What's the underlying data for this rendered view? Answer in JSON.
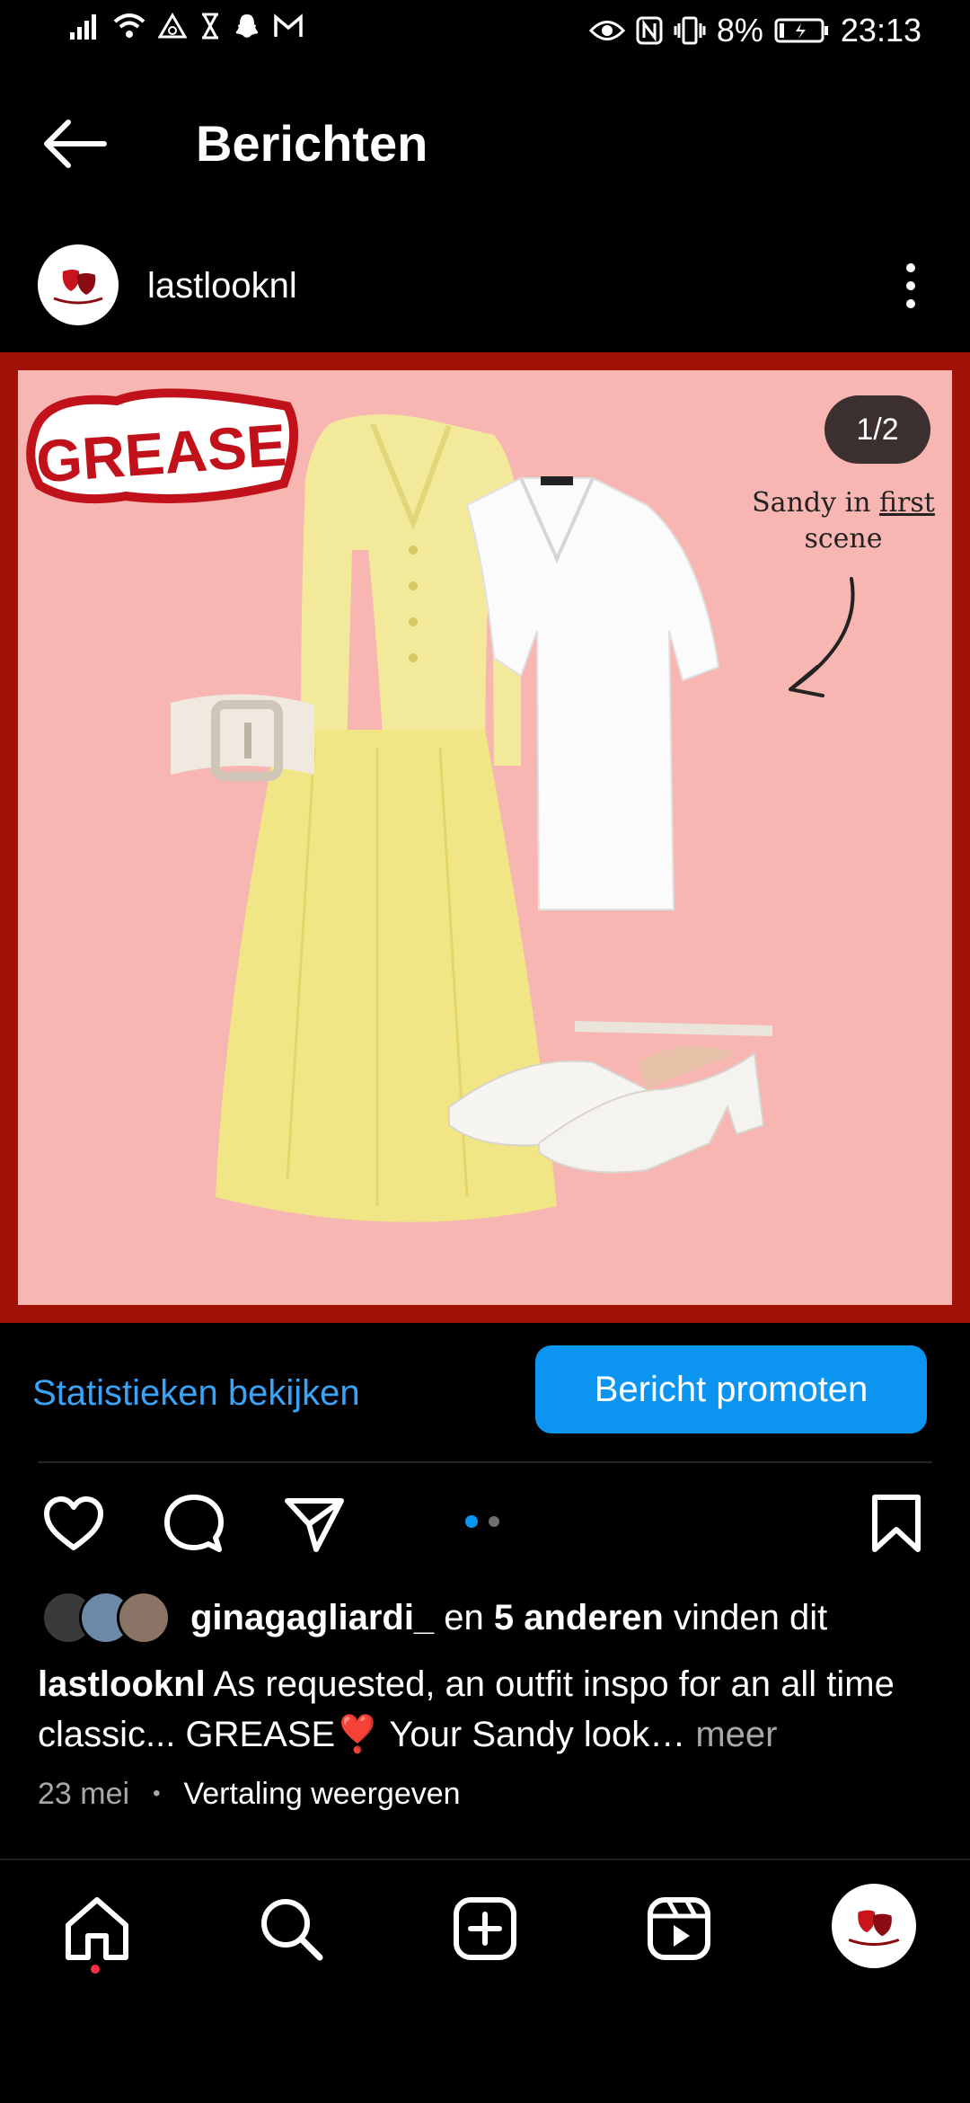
{
  "status_bar": {
    "left_icons": [
      "signal-icon",
      "wifi-icon",
      "alert-icon",
      "hourglass-icon",
      "snapchat-icon",
      "gmail-icon"
    ],
    "right_icons": [
      "eye-icon",
      "nfc-icon",
      "vibrate-icon"
    ],
    "battery": "8%",
    "time": "23:13"
  },
  "header": {
    "title": "Berichten"
  },
  "post": {
    "username": "lastlooknl",
    "image": {
      "counter": "1/2",
      "logo_text": "GREASE",
      "caption_line1": "Sandy in",
      "caption_underlined": "first",
      "caption_line2": "scene"
    },
    "stats_link": "Statistieken bekijken",
    "promote_button": "Bericht promoten",
    "carousel": {
      "count": 2,
      "active": 0
    },
    "likes": {
      "user": "ginagagliardi_",
      "middle": " en ",
      "others": "5 anderen",
      "suffix": " vinden dit"
    },
    "caption": {
      "username": "lastlooknl",
      "text": " As requested, an outfit inspo for an all time classic... GREASE❣️ Your Sandy look…",
      "more": " meer"
    },
    "date": "23 mei",
    "separator": "•",
    "translate": "Vertaling weergeven"
  },
  "colors": {
    "accent": "#0b95f0",
    "link": "#3aa3f7",
    "frame": "#a31207",
    "background_pink": "#f7b6b2"
  },
  "bottom_nav": [
    "home-icon",
    "search-icon",
    "create-icon",
    "reels-icon",
    "profile-avatar"
  ]
}
